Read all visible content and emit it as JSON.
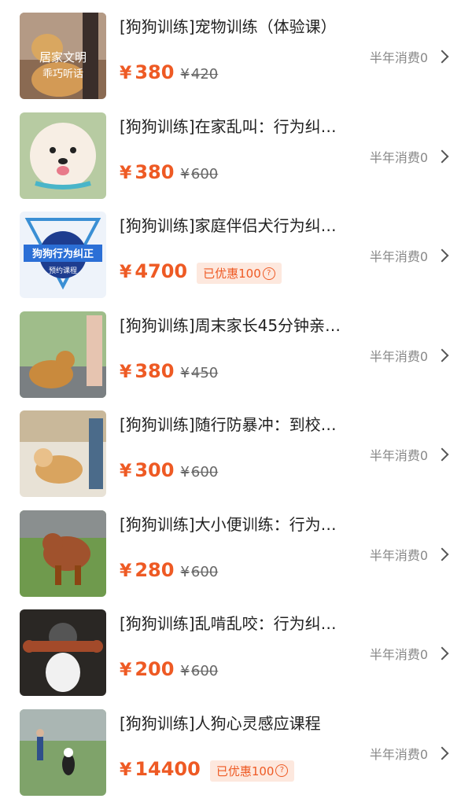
{
  "items": [
    {
      "title": "[狗狗训练]宠物训练（体验课）",
      "price_symbol": "¥",
      "price": "380",
      "orig_symbol": "¥",
      "orig": "420",
      "consume": "半年消费0",
      "thumb_text1": "居家文明",
      "thumb_text2": "乖巧听话"
    },
    {
      "title": "[狗狗训练]在家乱叫：行为纠…",
      "price_symbol": "¥",
      "price": "380",
      "orig_symbol": "¥",
      "orig": "600",
      "consume": "半年消费0"
    },
    {
      "title": "[狗狗训练]家庭伴侣犬行为纠…",
      "price_symbol": "¥",
      "price": "4700",
      "discount": "已优惠100",
      "consume": "半年消费0",
      "thumb_text1": "狗狗行为纠正",
      "thumb_text2": "预约课程"
    },
    {
      "title": "[狗狗训练]周末家长45分钟亲…",
      "price_symbol": "¥",
      "price": "380",
      "orig_symbol": "¥",
      "orig": "450",
      "consume": "半年消费0"
    },
    {
      "title": "[狗狗训练]随行防暴冲：到校…",
      "price_symbol": "¥",
      "price": "300",
      "orig_symbol": "¥",
      "orig": "600",
      "consume": "半年消费0"
    },
    {
      "title": "[狗狗训练]大小便训练：行为…",
      "price_symbol": "¥",
      "price": "280",
      "orig_symbol": "¥",
      "orig": "600",
      "consume": "半年消费0"
    },
    {
      "title": "[狗狗训练]乱啃乱咬：行为纠…",
      "price_symbol": "¥",
      "price": "200",
      "orig_symbol": "¥",
      "orig": "600",
      "consume": "半年消费0"
    },
    {
      "title": "[狗狗训练]人狗心灵感应课程",
      "price_symbol": "¥",
      "price": "14400",
      "discount": "已优惠100",
      "consume": "半年消费0"
    }
  ],
  "icons": {
    "chevron": "chevron-right-icon",
    "question": "question-circle-icon"
  },
  "colors": {
    "price": "#ee5a24",
    "discount_bg": "#fde8de"
  }
}
